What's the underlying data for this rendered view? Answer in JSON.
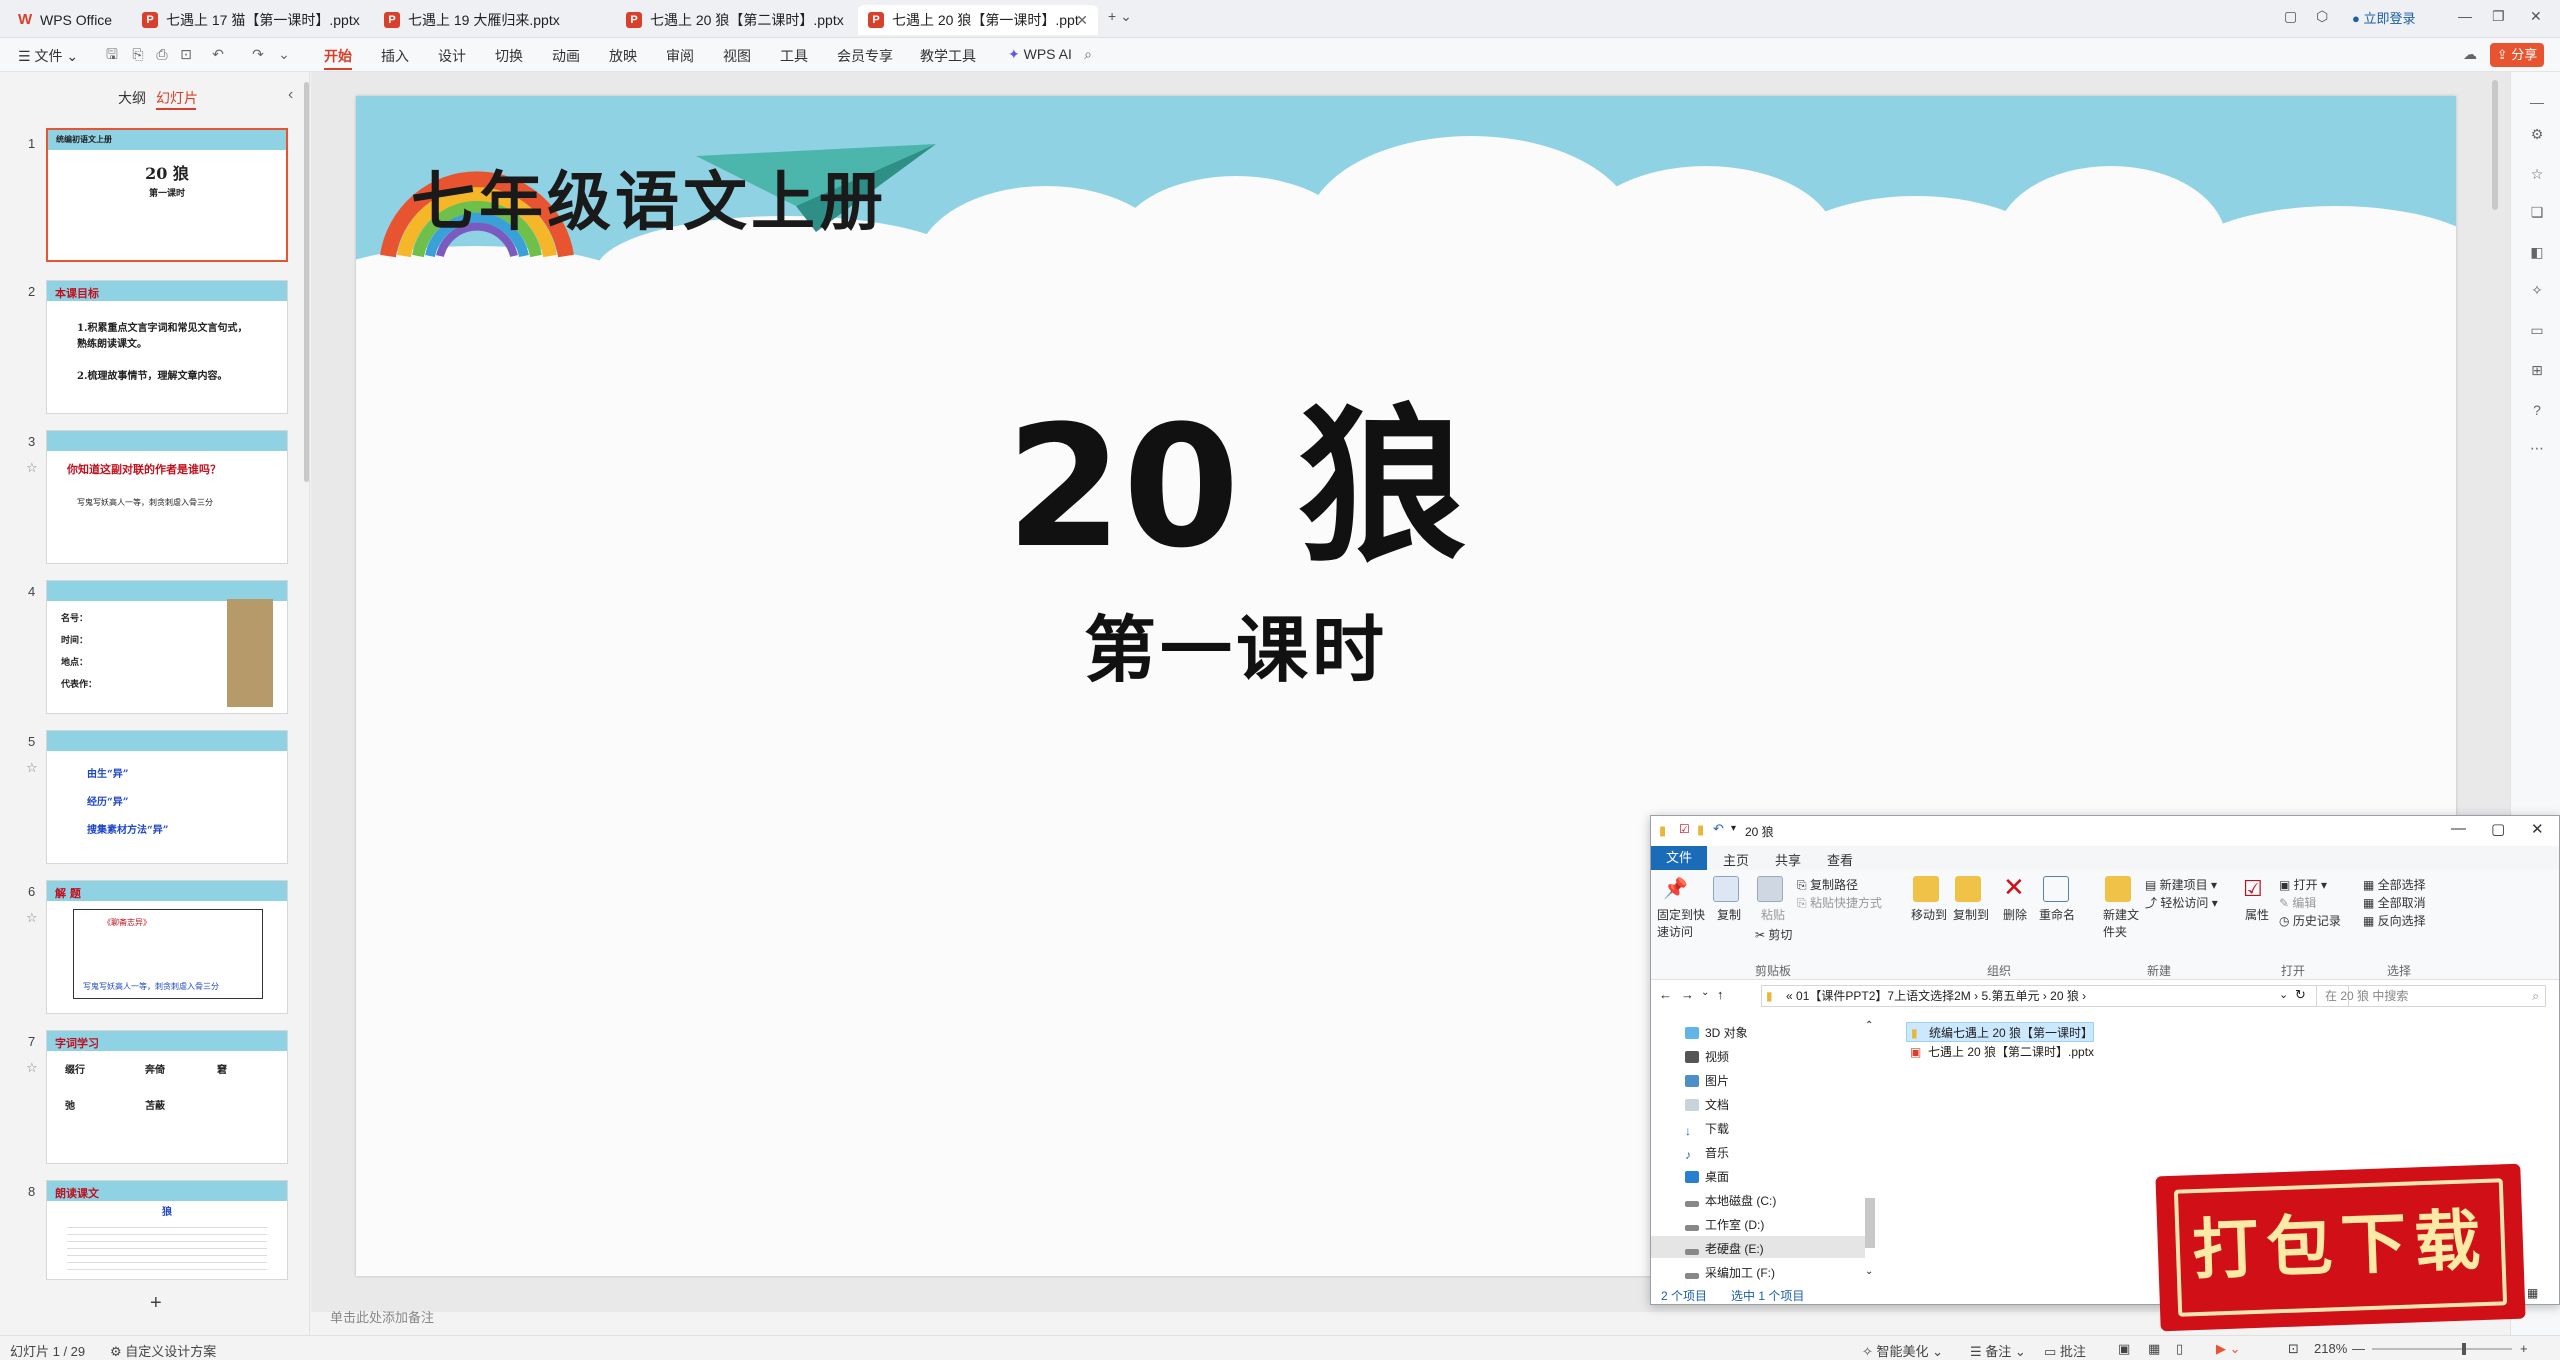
{
  "titlebar": {
    "tabs": [
      {
        "label": "WPS Office"
      },
      {
        "label": "七遇上 17 猫【第一课时】.pptx"
      },
      {
        "label": "七遇上 19 大雁归来.pptx"
      },
      {
        "label": "七遇上 20 狼【第二课时】.pptx"
      },
      {
        "label": "七遇上 20 狼【第一课时】.ppt"
      }
    ],
    "login": "立即登录"
  },
  "menubar": {
    "file": "文件",
    "items": [
      "开始",
      "插入",
      "设计",
      "切换",
      "动画",
      "放映",
      "审阅",
      "视图",
      "工具",
      "会员专享",
      "教学工具"
    ],
    "wps_ai": "WPS AI",
    "share": "分享"
  },
  "leftpanel": {
    "tab_outline": "大纲",
    "tab_slides": "幻灯片",
    "thumbnails": [
      {
        "num": "1",
        "lines": [
          "20  狼",
          "第一课时"
        ],
        "header": "统编初语文上册"
      },
      {
        "num": "2",
        "header": "本课目标",
        "lines": [
          "1.积累重点文言字词和常见文言句式，",
          "熟练朗读课文。",
          "2.梳理故事情节，理解文章内容。"
        ]
      },
      {
        "num": "3",
        "header": "你知道这副对联的作者是谁吗？",
        "lines": [
          "写鬼写妖高人一等，刺贪刺虐入骨三分"
        ]
      },
      {
        "num": "4",
        "header": "",
        "lines": [
          "名号：",
          "时间：",
          "地点：",
          "代表作："
        ]
      },
      {
        "num": "5",
        "header": "",
        "lines": [
          "由生“异”",
          "经历“异”",
          "搜集素材方法“异”"
        ]
      },
      {
        "num": "6",
        "header": "解  题",
        "lines": [
          "《聊斋志异》",
          "写鬼写妖高人一等，刺贪刺虐入骨三分"
        ]
      },
      {
        "num": "7",
        "header": "字词学习",
        "lines": [
          "缀行",
          "奔倚",
          "窘",
          "弛",
          "苫蔽"
        ]
      },
      {
        "num": "8",
        "header": "朗读课文",
        "lines": [
          "狼"
        ]
      }
    ],
    "add": "+"
  },
  "slide": {
    "header": "七年级语文上册",
    "title": "20    狼",
    "subtitle": "第一课时"
  },
  "notes_placeholder": "单击此处添加备注",
  "statusbar": {
    "slide_info": "幻灯片 1 / 29",
    "design": "自定义设计方案",
    "beautify": "智能美化",
    "notes": "备注",
    "comments": "批注",
    "zoom": "218%"
  },
  "explorer": {
    "title": "20 狼",
    "ribbon_tabs": [
      "文件",
      "主页",
      "共享",
      "查看"
    ],
    "clipboard": {
      "pin": "固定到快速访问",
      "copy": "复制",
      "paste": "粘贴",
      "copy_path": "复制路径",
      "paste_shortcut": "粘贴快捷方式",
      "cut": "剪切",
      "group": "剪贴板"
    },
    "organize": {
      "move": "移动到",
      "copy_to": "复制到",
      "delete": "删除",
      "rename": "重命名",
      "group": "组织"
    },
    "new": {
      "folder": "新建文件夹",
      "item": "新建项目",
      "easy_access": "轻松访问",
      "group": "新建"
    },
    "open": {
      "props": "属性",
      "open": "打开",
      "edit": "编辑",
      "history": "历史记录",
      "group": "打开"
    },
    "select": {
      "all": "全部选择",
      "none": "全部取消",
      "invert": "反向选择",
      "group": "选择"
    },
    "path": [
      "«",
      "01【课件PPT2】7上语文选择2M",
      "›",
      "5.第五单元",
      "›",
      "20 狼",
      "›"
    ],
    "search_placeholder": "在 20 狼 中搜索",
    "nav": [
      "3D 对象",
      "视频",
      "图片",
      "文档",
      "下载",
      "音乐",
      "桌面",
      "本地磁盘 (C:)",
      "工作室 (D:)",
      "老硬盘 (E:)",
      "采编加工 (F:)"
    ],
    "files": [
      "统编七遇上 20 狼【第一课时】",
      "七遇上 20 狼【第二课时】.pptx"
    ],
    "status_count": "2 个项目",
    "status_selected": "选中 1 个项目"
  },
  "stamp": {
    "text": "打包下载"
  },
  "colors": {
    "accent": "#d9402b",
    "sky": "#8fd2e4",
    "stamp": "#d10f17"
  }
}
